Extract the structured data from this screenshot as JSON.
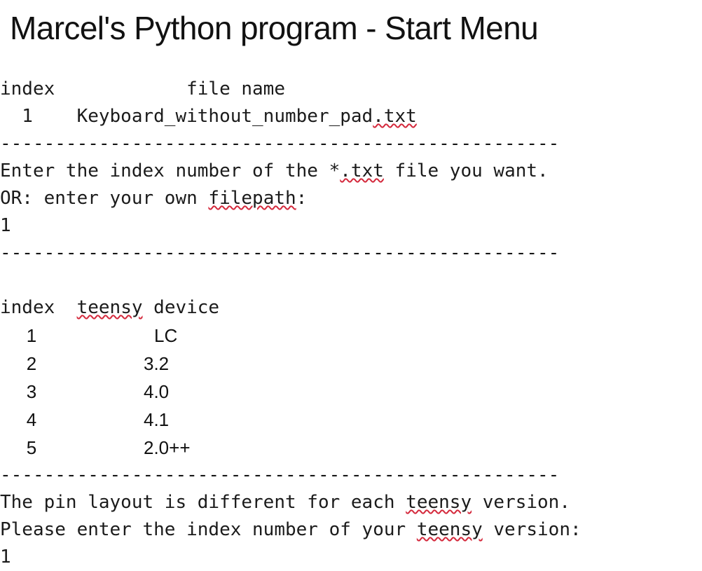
{
  "window": {
    "title": "Marcel's Python program - Start Menu"
  },
  "separator": {
    "glyph": "-",
    "count": 51,
    "line": "---------------------------------------------------"
  },
  "file_section": {
    "header": {
      "index_label": "index",
      "filename_label": "file name",
      "raw": "index            file name"
    },
    "rows": [
      {
        "index": "1",
        "file_name": "Keyboard_without_number_pad",
        "extension": ".txt",
        "raw": "  1    Keyboard_without_number_pad.txt"
      }
    ],
    "prompt_line_1_a": "Enter the index number of the *",
    "prompt_line_1_misspelled": ".txt",
    "prompt_line_1_b": " file you want.",
    "prompt_line_2_a": "OR: enter your own ",
    "prompt_line_2_misspelled": "filepath",
    "prompt_line_2_b": ":",
    "user_input": "1"
  },
  "teensy_section": {
    "header": {
      "index_label": "index",
      "device_label_misspelled": "teensy",
      "device_label_rest": " device",
      "gap": "  "
    },
    "rows": [
      {
        "index": "1",
        "device": "LC"
      },
      {
        "index": "2",
        "device": "3.2"
      },
      {
        "index": "3",
        "device": "4.0"
      },
      {
        "index": "4",
        "device": "4.1"
      },
      {
        "index": "5",
        "device": "2.0++"
      }
    ],
    "prompt_line_1_a": "The pin layout is different for each ",
    "prompt_line_1_misspelled": "teensy",
    "prompt_line_1_b": " version.",
    "prompt_line_2_a": "Please enter the index number of your ",
    "prompt_line_2_misspelled": "teensy",
    "prompt_line_2_b": " version:",
    "user_input": "1"
  },
  "colors": {
    "background": "#ffffff",
    "text": "#1a1a1a",
    "spellcheck_underline": "#d4293c"
  }
}
